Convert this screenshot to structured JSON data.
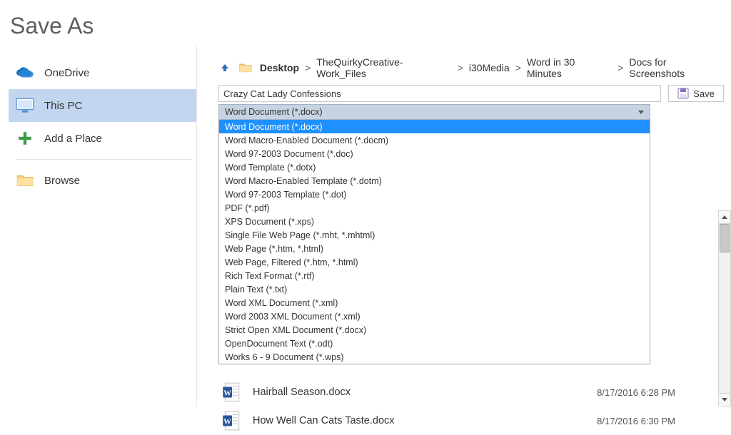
{
  "title": "Save As",
  "sidebar": {
    "items": [
      {
        "label": "OneDrive",
        "icon": "onedrive"
      },
      {
        "label": "This PC",
        "icon": "thispc"
      },
      {
        "label": "Add a Place",
        "icon": "addplace"
      },
      {
        "label": "Browse",
        "icon": "browse"
      }
    ],
    "selected_index": 1
  },
  "breadcrumb": {
    "segments": [
      "Desktop",
      "TheQuirkyCreative-Work_Files",
      "i30Media",
      "Word in 30 Minutes",
      "Docs for Screenshots"
    ]
  },
  "filename": "Crazy Cat Lady Confessions",
  "save_button_label": "Save",
  "file_type": {
    "selected": "Word Document (*.docx)",
    "highlighted_index": 0,
    "options": [
      "Word Document (*.docx)",
      "Word Macro-Enabled Document (*.docm)",
      "Word 97-2003 Document (*.doc)",
      "Word Template (*.dotx)",
      "Word Macro-Enabled Template (*.dotm)",
      "Word 97-2003 Template (*.dot)",
      "PDF (*.pdf)",
      "XPS Document (*.xps)",
      "Single File Web Page (*.mht, *.mhtml)",
      "Web Page (*.htm, *.html)",
      "Web Page, Filtered (*.htm, *.html)",
      "Rich Text Format (*.rtf)",
      "Plain Text (*.txt)",
      "Word XML Document (*.xml)",
      "Word 2003 XML Document (*.xml)",
      "Strict Open XML Document (*.docx)",
      "OpenDocument Text (*.odt)",
      "Works 6 - 9 Document (*.wps)"
    ]
  },
  "files": [
    {
      "name": "Hairball Season.docx",
      "date": "8/17/2016 6:28 PM"
    },
    {
      "name": "How Well Can Cats Taste.docx",
      "date": "8/17/2016 6:30 PM"
    }
  ],
  "colors": {
    "sidebar_selected": "#c2d6f0",
    "dropdown_highlight": "#1e90ff",
    "type_select_bg": "#c8d3e1"
  }
}
